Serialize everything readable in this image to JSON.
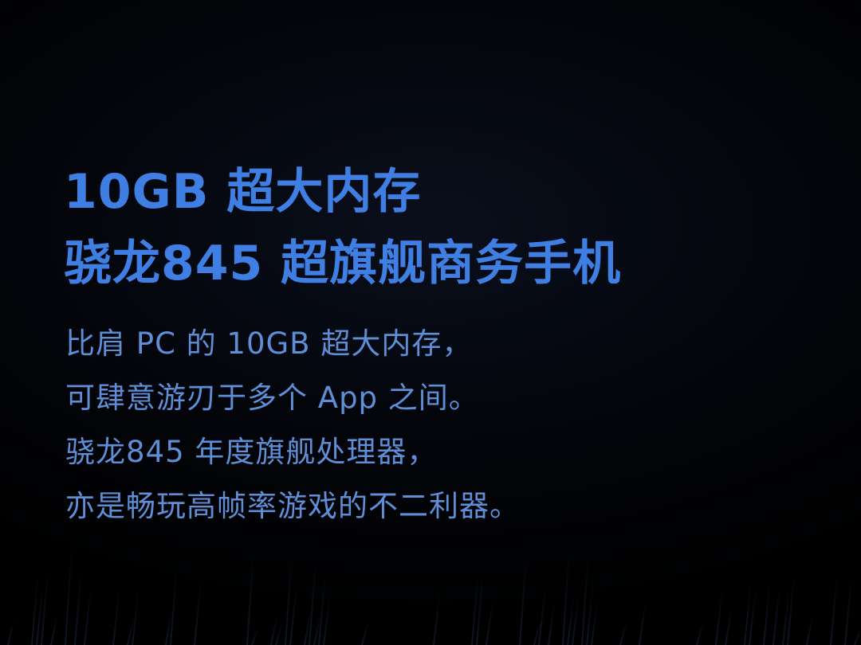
{
  "headline": {
    "line1": "10GB 超大内存",
    "line2": "骁龙845 超旗舰商务手机"
  },
  "body": {
    "lines": [
      "比肩 PC 的 10GB 超大内存，",
      "可肆意游刃于多个 App 之间。",
      "骁龙845 年度旗舰处理器，",
      "亦是畅玩高帧率游戏的不二利器。"
    ]
  },
  "colors": {
    "background": "#000000",
    "headline": "#3f7ee3",
    "body": "#5f8ed6",
    "texture": "#1c2a44"
  }
}
